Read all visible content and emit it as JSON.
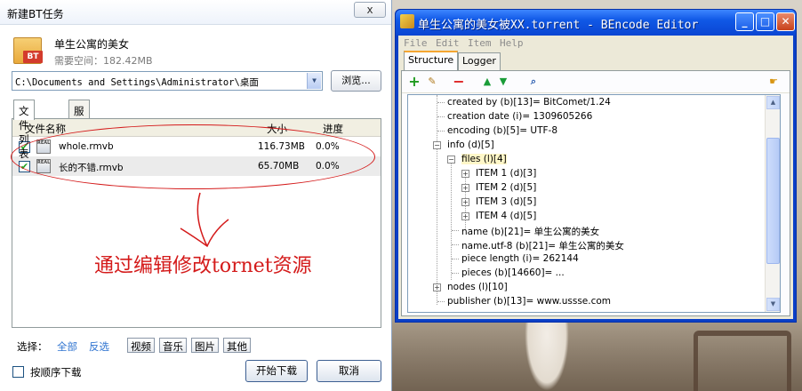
{
  "left_dialog": {
    "title": "新建BT任务",
    "close_label": "x",
    "task_name": "单生公寓的美女",
    "space_required": "需要空间：182.42MB",
    "icon_tag": "BT",
    "save_path": "C:\\Documents and Settings\\Administrator\\桌面",
    "browse_label": "浏览...",
    "tabs": [
      "文件列表",
      "服务器"
    ],
    "columns": [
      "文件名称",
      "大小",
      "进度"
    ],
    "files": [
      {
        "name": "whole.rmvb",
        "size": "116.73MB",
        "progress": "0.0%",
        "icon_text": "REAL"
      },
      {
        "name": "长的不错.rmvb",
        "size": "65.70MB",
        "progress": "0.0%",
        "icon_text": "REAL"
      }
    ],
    "filter_label": "选择：",
    "filter_all": "全部",
    "filter_invert": "反选",
    "filter_types": [
      "视频",
      "音乐",
      "图片",
      "其他"
    ],
    "order_label": "按顺序下载",
    "start_label": "开始下载",
    "cancel_label": "取消",
    "annotation": "通过编辑修改tornet资源"
  },
  "editor": {
    "title": "单生公寓的美女被XX.torrent - BEncode Editor",
    "menu": [
      "File",
      "Edit",
      "Item",
      "Help"
    ],
    "tabs": [
      "Structure",
      "Logger"
    ],
    "tree": [
      "created by (b)[13]= BitComet/1.24",
      "creation date (i)= 1309605266",
      "encoding (b)[5]= UTF-8",
      "info (d)[5]",
      "files (l)[4]",
      "ITEM 1 (d)[3]",
      "ITEM 2 (d)[5]",
      "ITEM 3 (d)[5]",
      "ITEM 4 (d)[5]",
      "name (b)[21]= 单生公寓的美女",
      "name.utf-8 (b)[21]= 单生公寓的美女",
      "piece length (i)= 262144",
      "pieces (b)[14660]= ...",
      "nodes (l)[10]",
      "publisher (b)[13]= www.ussse.com"
    ]
  },
  "colors": {
    "xp_blue": "#0a45d2",
    "annotation_red": "#d41a1a",
    "link_blue": "#2f74d0"
  }
}
